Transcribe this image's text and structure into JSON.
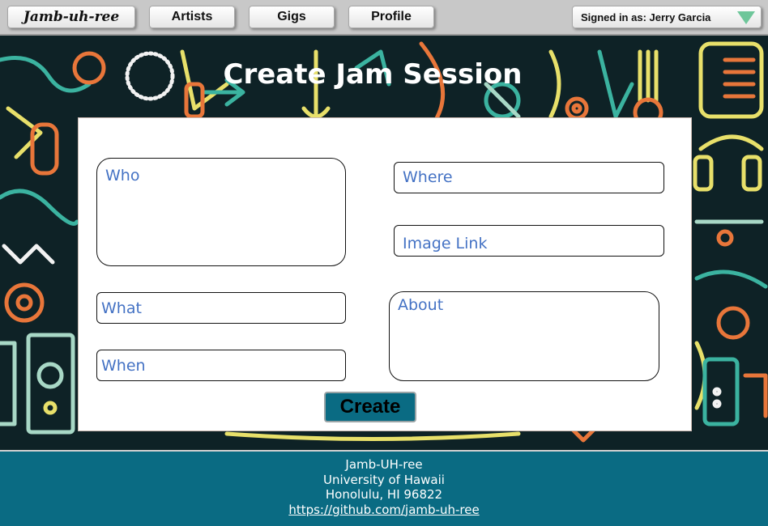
{
  "nav": {
    "brand": "Jamb-uh-ree",
    "artists": "Artists",
    "gigs": "Gigs",
    "profile": "Profile",
    "signed_in": "Signed in as: Jerry Garcia"
  },
  "page": {
    "title": "Create Jam Session"
  },
  "form": {
    "who": "Who",
    "where": "Where",
    "image_link": "Image Link",
    "what": "What",
    "about": "About",
    "when": "When",
    "submit": "Create"
  },
  "footer": {
    "line1": "Jamb-UH-ree",
    "line2": "University of Hawaii",
    "line3": "Honolulu, HI 96822",
    "link": "https://github.com/jamb-uh-ree"
  },
  "colors": {
    "accent": "#0a6b83",
    "placeholder": "#4472c4",
    "hero_bg": "#0e2226"
  }
}
